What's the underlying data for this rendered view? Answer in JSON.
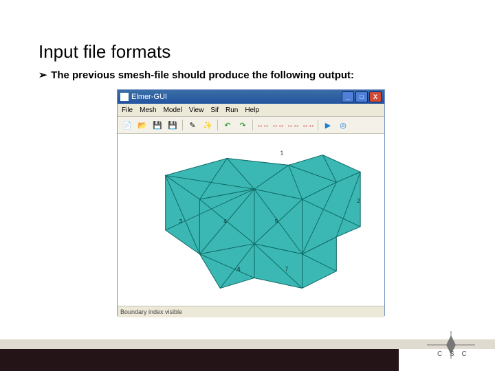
{
  "slide": {
    "title": "Input file formats",
    "bullet_arrow": "➢",
    "bullet_text": "The previous smesh-file should produce the following output:"
  },
  "app_window": {
    "title": "Elmer-GUI",
    "menu": [
      "File",
      "Mesh",
      "Model",
      "View",
      "Sif",
      "Run",
      "Help"
    ],
    "toolbar_icons": {
      "new": "new-icon",
      "open": "open-icon",
      "save": "save-icon",
      "save_as": "save-as-icon",
      "pencil": "pencil-icon",
      "wand": "wand-icon",
      "undo": "undo-icon",
      "redo": "redo-icon",
      "arrows_1": "↔↔",
      "arrows_2": "↔↔",
      "arrows_3": "↔↔",
      "arrows_4": "↔↔",
      "play": "play-icon",
      "scope": "scope-icon"
    },
    "status_text": "Boundary index visible",
    "window_controls": {
      "min": "_",
      "max": "□",
      "close": "X"
    }
  },
  "mesh": {
    "color_face": "#3bb8b3",
    "color_edge": "#0f6a67",
    "node_labels": [
      "1",
      "2",
      "3",
      "4",
      "5",
      "6",
      "7"
    ]
  },
  "logo": {
    "text": "C S C"
  }
}
